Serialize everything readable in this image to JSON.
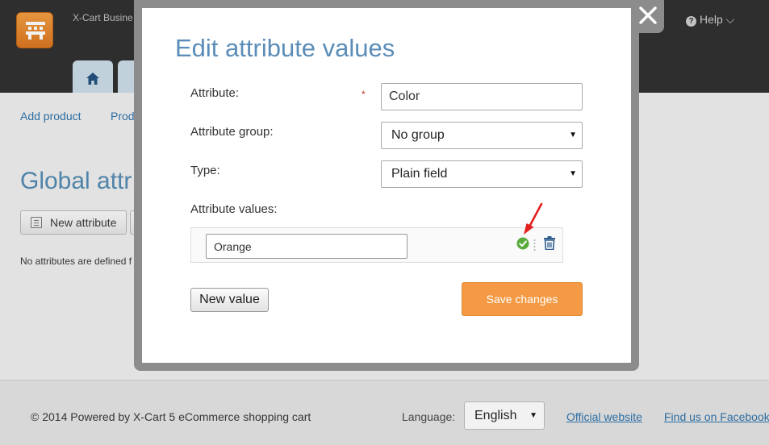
{
  "header": {
    "brand": "X-Cart Busine",
    "help_label": "Help ⌵"
  },
  "subnav": [
    "Add product",
    "Prod"
  ],
  "page": {
    "title": "Global attr",
    "new_attribute_label": "New attribute",
    "empty_message": "No attributes are defined f"
  },
  "modal": {
    "title": "Edit attribute values",
    "attribute_label": "Attribute:",
    "required_mark": "*",
    "attribute_value": "Color",
    "group_label": "Attribute group:",
    "group_value": "No group",
    "type_label": "Type:",
    "type_value": "Plain field",
    "values_label": "Attribute values:",
    "values": [
      {
        "value": "Orange"
      }
    ],
    "new_value_label": "New value",
    "save_label": "Save changes"
  },
  "footer": {
    "copyright": "© 2014 Powered by X-Cart 5 eCommerce shopping cart",
    "language_label": "Language:",
    "language_value": "English",
    "official_website": "Official website",
    "facebook": "Find us on Facebook"
  },
  "colors": {
    "accent": "#f49a45",
    "title_blue": "#5b8db8",
    "link_blue": "#2a6fa8",
    "success_green": "#5aaa3c",
    "annotation_red": "#e32020"
  },
  "icons": [
    "app-logo-icon",
    "home-icon",
    "question-icon",
    "list-icon",
    "close-icon",
    "check-circle-icon",
    "drag-handle-icon",
    "trash-icon",
    "caret-down-icon",
    "red-arrow-annotation"
  ]
}
